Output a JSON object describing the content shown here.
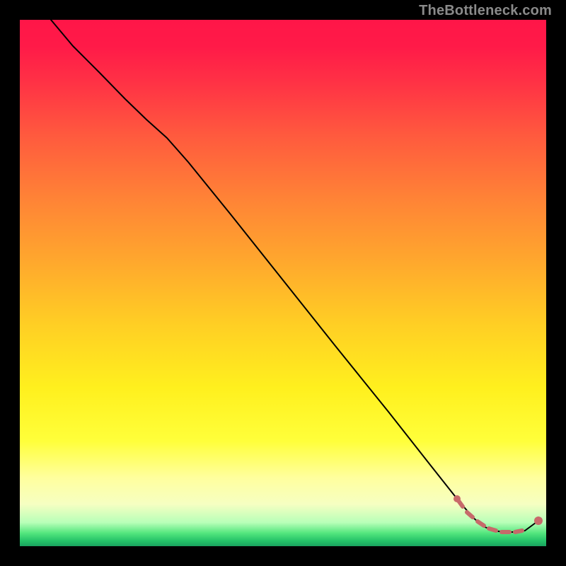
{
  "watermark": "TheBottleneck.com",
  "colors": {
    "background": "#000000",
    "curve": "#000000",
    "dash": "#c66a6a",
    "marker": "#c96a6a"
  },
  "chart_data": {
    "type": "line",
    "title": "",
    "xlabel": "",
    "ylabel": "",
    "xlim": [
      0,
      100
    ],
    "ylim": [
      0,
      100
    ],
    "grid": false,
    "legend": null,
    "annotations": [
      "TheBottleneck.com"
    ],
    "note": "x/y estimated from pixel geometry; chart has no axes or tick labels.",
    "series": [
      {
        "name": "curve",
        "style": "solid",
        "color": "#000000",
        "x": [
          6.0,
          10.0,
          15.0,
          20.0,
          24.0,
          28.0,
          32.0,
          40.0,
          50.0,
          60.0,
          70.0,
          78.0,
          83.0,
          86.0,
          88.0,
          90.0,
          92.0,
          94.0,
          96.0,
          98.5
        ],
        "y": [
          100.0,
          95.0,
          90.0,
          85.0,
          81.0,
          77.5,
          73.0,
          63.0,
          50.5,
          38.0,
          25.5,
          15.5,
          9.0,
          5.5,
          3.8,
          3.0,
          2.7,
          2.7,
          3.0,
          4.8
        ]
      },
      {
        "name": "highlight",
        "style": "dashed-with-markers",
        "color": "#c66a6a",
        "x": [
          83.0,
          85.0,
          87.0,
          89.0,
          91.0,
          93.0,
          95.0,
          98.5
        ],
        "y": [
          9.0,
          5.8,
          4.2,
          3.2,
          2.8,
          2.7,
          2.8,
          4.8
        ]
      }
    ]
  }
}
